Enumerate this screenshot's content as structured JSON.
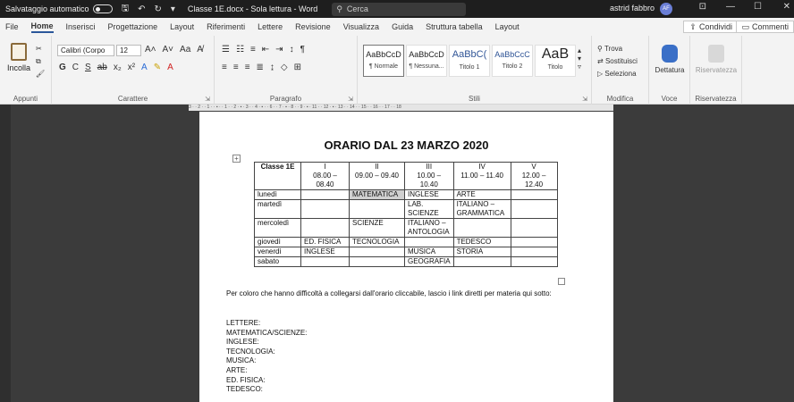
{
  "titlebar": {
    "autosave": "Salvataggio automatico",
    "title": "Classe 1E.docx - Sola lettura - Word",
    "search_placeholder": "Cerca",
    "user": "astrid fabbro",
    "avatar_initials": "AF"
  },
  "menu": {
    "tabs": [
      "File",
      "Home",
      "Inserisci",
      "Progettazione",
      "Layout",
      "Riferimenti",
      "Lettere",
      "Revisione",
      "Visualizza",
      "Guida",
      "Struttura tabella",
      "Layout"
    ],
    "share": "Condividi",
    "comments": "Commenti"
  },
  "ribbon": {
    "paste": "Incolla",
    "font_name": "Calibri (Corpo",
    "font_size": "12",
    "styles": [
      {
        "preview": "AaBbCcD",
        "name": "¶ Normale"
      },
      {
        "preview": "AaBbCcD",
        "name": "¶ Nessuna..."
      },
      {
        "preview": "AaBbC(",
        "name": "Titolo 1"
      },
      {
        "preview": "AaBbCcC",
        "name": "Titolo 2"
      },
      {
        "preview": "AaB",
        "name": "Titolo"
      }
    ],
    "find": "Trova",
    "replace": "Sostituisci",
    "select": "Seleziona",
    "dictate": "Dettatura",
    "sensitivity": "Riservatezza",
    "groups": {
      "clipboard": "Appunti",
      "font": "Carattere",
      "paragraph": "Paragrafo",
      "styles": "Stili",
      "editing": "Modifica",
      "voice": "Voce",
      "sensitivity": "Riservatezza"
    }
  },
  "ruler": "3 · · 2 · · 1 · · ▪ · · 1 · · 2 · ▪ · 3 · · 4 · ▪ · · 6 · · 7 · ▪ · 8 · · 9 · ▪ · 11 · · 12 · ▪ · 13 · · 14 · · 15 · · 16 · · 17 · · 18",
  "document": {
    "heading": "ORARIO DAL 23 MARZO 2020",
    "table": {
      "header": [
        {
          "l1": "Classe 1E",
          "l2": "",
          "l3": ""
        },
        {
          "l1": "I",
          "l2": "08.00 –",
          "l3": "08.40"
        },
        {
          "l1": "II",
          "l2": "09.00 – 09.40",
          "l3": ""
        },
        {
          "l1": "III",
          "l2": "10.00 –",
          "l3": "10.40"
        },
        {
          "l1": "IV",
          "l2": "11.00 – 11.40",
          "l3": ""
        },
        {
          "l1": "V",
          "l2": "12.00 –",
          "l3": "12.40"
        }
      ],
      "rows": [
        {
          "day": "lunedì",
          "c1": "",
          "c2": "MATEMATICA",
          "c3": "INGLESE",
          "c4": "ARTE",
          "c5": ""
        },
        {
          "day": "martedì",
          "c1": "",
          "c2": "",
          "c3": "LAB.\nSCIENZE",
          "c4": "ITALIANO –\nGRAMMATICA",
          "c5": ""
        },
        {
          "day": "mercoledì",
          "c1": "",
          "c2": "SCIENZE",
          "c3": "ITALIANO –\nANTOLOGIA",
          "c4": "",
          "c5": ""
        },
        {
          "day": "giovedì",
          "c1": "ED. FISICA",
          "c2": "TECNOLOGIA",
          "c3": "",
          "c4": "TEDESCO",
          "c5": ""
        },
        {
          "day": "venerdì",
          "c1": "INGLESE",
          "c2": "",
          "c3": "MUSICA",
          "c4": "STORIA",
          "c5": ""
        },
        {
          "day": "sabato",
          "c1": "",
          "c2": "",
          "c3": "GEOGRAFIA",
          "c4": "",
          "c5": ""
        }
      ]
    },
    "paragraph": "Per coloro che hanno difficoltà a collegarsi dall'orario cliccabile, lascio i link diretti per materia qui sotto:",
    "subjects": [
      "LETTERE:",
      "MATEMATICA/SCIENZE:",
      "INGLESE:",
      "TECNOLOGIA:",
      "MUSICA:",
      "ARTE:",
      "ED. FISICA:",
      "TEDESCO:"
    ]
  }
}
